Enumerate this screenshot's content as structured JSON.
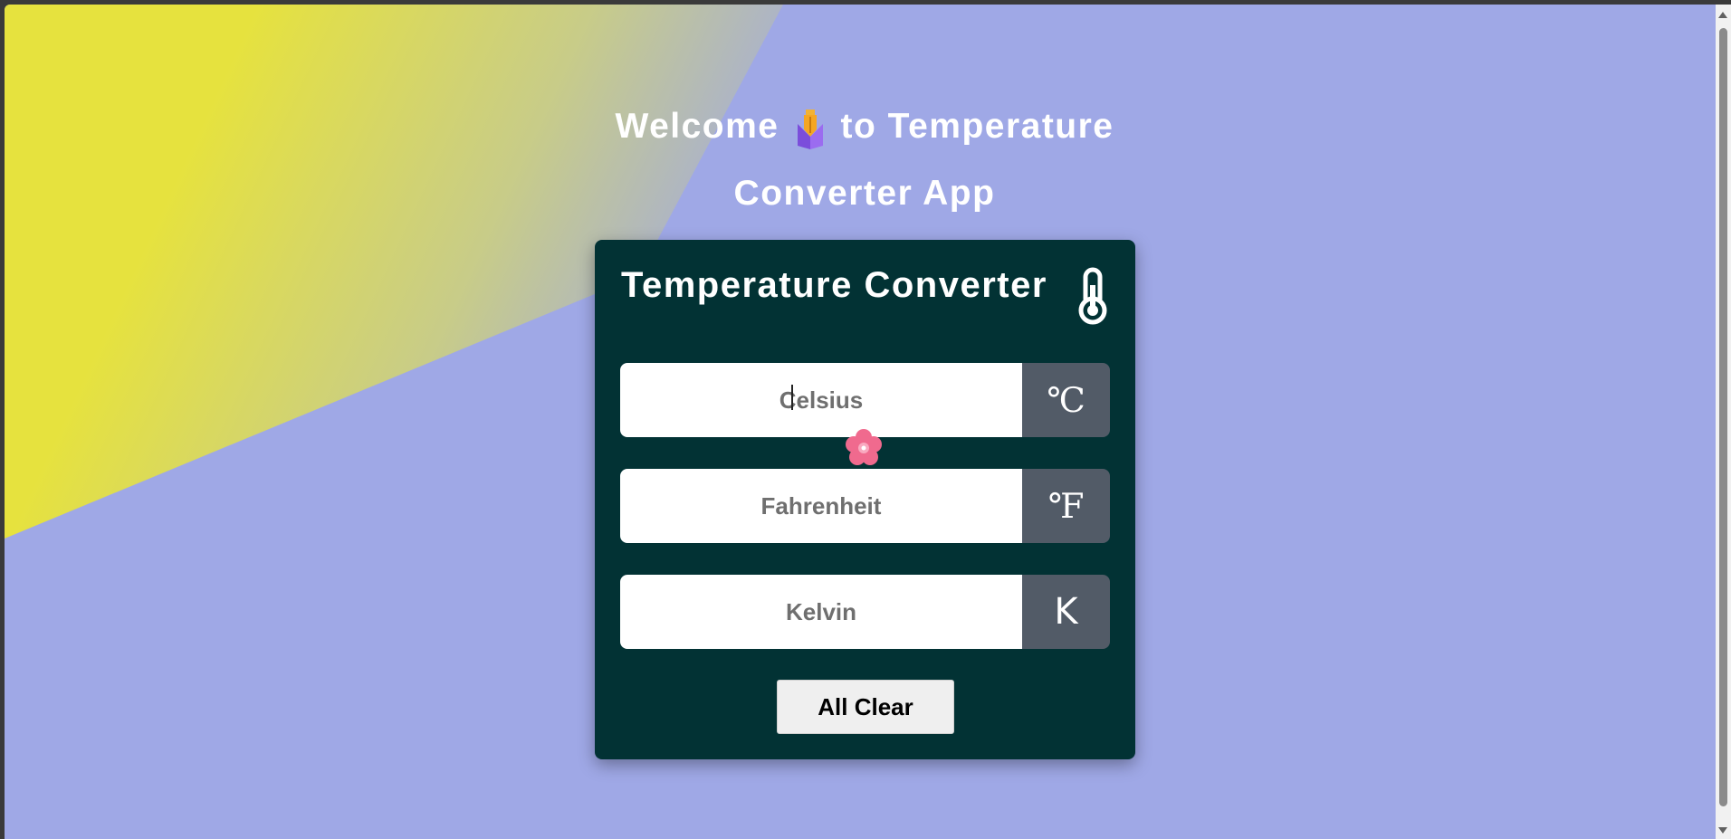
{
  "welcome": {
    "line1_before": "Welcome",
    "line1_after": "to Temperature",
    "line2": "Converter App",
    "icon": "pen-nib-icon"
  },
  "converter": {
    "title": "Temperature Converter",
    "title_icon": "thermometer-icon",
    "fields": [
      {
        "placeholder": "Celsius",
        "value": "",
        "unit": "℃"
      },
      {
        "placeholder": "Fahrenheit",
        "value": "",
        "unit": "℉"
      },
      {
        "placeholder": "Kelvin",
        "value": "",
        "unit": "K"
      }
    ],
    "clear_label": "All Clear"
  },
  "decorations": {
    "cursor_icon": "cherry-blossom-cursor-icon"
  },
  "colors": {
    "background": "#9fa8e6",
    "accent_yellow": "#e6e23e",
    "card": "#023234",
    "unit_box": "#525b67",
    "button": "#efefef"
  }
}
